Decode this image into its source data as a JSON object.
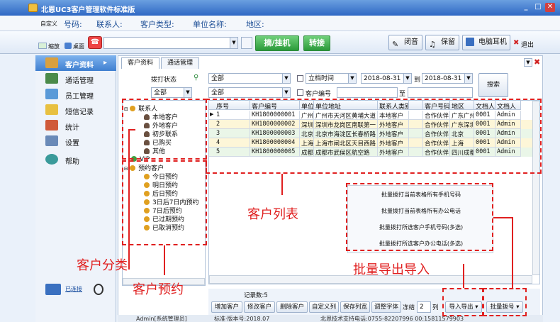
{
  "window": {
    "title": "北恩UC3客户管理软件标准版",
    "minimize": "_",
    "maximize": "□",
    "close": "✕"
  },
  "infobar": {
    "customize": "自定义",
    "labels": [
      "号码:",
      "联系人:",
      "客户类型:",
      "单位名称:",
      "地区:"
    ]
  },
  "toolbar": {
    "shrink_label": "缩放",
    "desktop_label": "桌面",
    "dial_label": "摘/挂机",
    "transfer_label": "转接",
    "mute_label": "闭音",
    "hold_label": "保留",
    "headset_label": "电脑耳机",
    "exit_label": "退出"
  },
  "nav": {
    "items": [
      {
        "label": "客户资料",
        "icon": "customer-icon",
        "active": true,
        "arrow": "▸"
      },
      {
        "label": "通话管理",
        "icon": "call-icon"
      },
      {
        "label": "员工管理",
        "icon": "staff-icon"
      },
      {
        "label": "短信记录",
        "icon": "sms-icon"
      },
      {
        "label": "统计",
        "icon": "chart-icon"
      },
      {
        "label": "设置",
        "icon": "settings-icon"
      },
      {
        "label": "帮助",
        "icon": "help-icon"
      }
    ],
    "connection_status": "已连接"
  },
  "tabs": [
    "客户资料",
    "通话管理"
  ],
  "filters": {
    "dial_status_label": "拨打状态",
    "dial_status_value": "全部",
    "select_all": "全部",
    "sub_all": "全部",
    "archive_time_label": "立档时间",
    "date_from": "2018-08-31",
    "to_label": "到",
    "date_to": "2018-08-31",
    "customer_no_label": "客户编号",
    "range_to": "至",
    "search_label": "搜索"
  },
  "tree": {
    "contacts_root": "联系人",
    "contact_items": [
      "本地客户",
      "外地客户",
      "初步联系",
      "已购买",
      "其他"
    ],
    "vip": "VIP",
    "appointment_root": "预约客户",
    "appointment_items": [
      "今日预约",
      "明日预约",
      "后日预约",
      "3日后7日内预约",
      "7日后预约",
      "已过期预约",
      "已取消预约"
    ]
  },
  "grid": {
    "columns": [
      "序号",
      "客户编号",
      "单位",
      "单位地址",
      "联系人类别",
      "客户号码",
      "地区",
      "文档人员",
      "文档人"
    ],
    "rows": [
      [
        "1",
        "KH1800000001",
        "广州",
        "广州市天河区黄埔大道",
        "本地客户",
        "",
        "合作伙伴",
        "广东广州",
        "0001",
        "Admin"
      ],
      [
        "2",
        "KH1800000002",
        "深圳",
        "深圳市龙岗区南联第一",
        "外地客户",
        "",
        "合作伙伴",
        "广东深圳",
        "0001",
        "Admin"
      ],
      [
        "3",
        "KH1800000003",
        "北京",
        "北京市海淀区长春桥路",
        "外地客户",
        "",
        "合作伙伴",
        "北京",
        "0001",
        "Admin"
      ],
      [
        "4",
        "KH1800000004",
        "上海",
        "上海市闸北区天目西路",
        "外地客户",
        "",
        "合作伙伴",
        "上海",
        "0001",
        "Admin"
      ],
      [
        "5",
        "KH1800000005",
        "成都",
        "成都市武侯区航空路",
        "外地客户",
        "",
        "合作伙伴",
        "四川成都",
        "0001",
        "Admin"
      ]
    ],
    "record_count": "记录数:5"
  },
  "popup_menu": {
    "items": [
      "批量拨打当前表格所有手机号码",
      "批量拨打当前表格所有办公电话",
      "批量拨打所选客户手机号码(多选)",
      "批量拨打所选客户办公电话(多选)"
    ]
  },
  "bottom_buttons": {
    "add": "增加客户",
    "edit": "修改客户",
    "delete": "删除客户",
    "custom_columns": "自定义列",
    "save_columns": "保存列宽",
    "font": "调整字体",
    "freeze": "冻结",
    "freeze_value": "2",
    "col": "列",
    "import_export": "导入导出",
    "batch_dial": "批量拨号"
  },
  "statusbar": {
    "user": "Admin[系统管理员]",
    "version": "标准·版本号:2018.07",
    "support": "北恩技术支持电话:0755-82207996  00:15811579903"
  },
  "annotations": {
    "classify": "客户分类",
    "appointment": "客户预约",
    "list": "客户列表",
    "batch": "批量导出导入"
  }
}
